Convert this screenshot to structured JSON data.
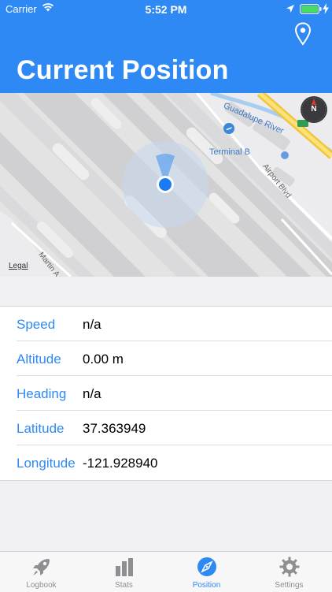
{
  "status_bar": {
    "carrier": "Carrier",
    "time": "5:52 PM"
  },
  "header": {
    "title": "Current Position"
  },
  "map": {
    "labels": {
      "river": "Guadalupe River",
      "terminal": "Terminal B",
      "street1": "Airport Blvd",
      "street2": "Martin A",
      "legal": "Legal"
    },
    "compass": "N"
  },
  "position": {
    "rows": [
      {
        "label": "Speed",
        "value": "n/a"
      },
      {
        "label": "Altitude",
        "value": "0.00 m"
      },
      {
        "label": "Heading",
        "value": "n/a"
      },
      {
        "label": "Latitude",
        "value": "37.363949"
      },
      {
        "label": "Longitude",
        "value": "-121.928940"
      }
    ]
  },
  "tabs": [
    {
      "label": "Logbook",
      "icon": "rocket-icon"
    },
    {
      "label": "Stats",
      "icon": "bar-chart-icon"
    },
    {
      "label": "Position",
      "icon": "compass-icon",
      "active": true
    },
    {
      "label": "Settings",
      "icon": "gear-icon"
    }
  ],
  "colors": {
    "accent": "#2f89f5",
    "tab_inactive": "#8e8e93"
  }
}
